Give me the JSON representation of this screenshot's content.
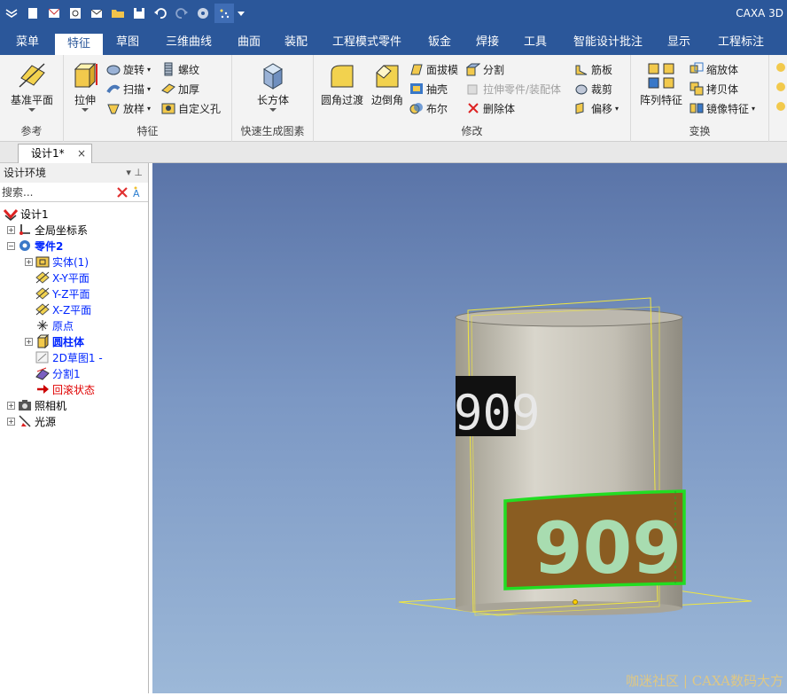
{
  "app": {
    "title": "CAXA 3D"
  },
  "quick_access": {
    "icons": [
      "app-logo-icon",
      "new-icon",
      "open-mail-icon",
      "scan-icon",
      "mail-icon",
      "folder-icon",
      "save-icon",
      "undo-icon",
      "redo-icon",
      "gear-icon",
      "sparkle-icon",
      "dropdown-icon"
    ]
  },
  "tabs": [
    {
      "label": "菜单"
    },
    {
      "label": "特征"
    },
    {
      "label": "草图"
    },
    {
      "label": "三维曲线"
    },
    {
      "label": "曲面"
    },
    {
      "label": "装配"
    },
    {
      "label": "工程模式零件"
    },
    {
      "label": "钣金"
    },
    {
      "label": "焊接"
    },
    {
      "label": "工具"
    },
    {
      "label": "智能设计批注"
    },
    {
      "label": "显示"
    },
    {
      "label": "工程标注"
    }
  ],
  "ribbon": {
    "ref": {
      "label": "参考",
      "base_plane": "基准平面"
    },
    "feature": {
      "label": "特征",
      "extrude": "拉伸",
      "revolve": "旋转",
      "sweep": "扫描",
      "loft": "放样",
      "thread": "螺纹",
      "thicken": "加厚",
      "custom_hole": "自定义孔"
    },
    "quick": {
      "label": "快速生成图素",
      "box": "长方体"
    },
    "modify": {
      "label": "修改",
      "fillet": "圆角过渡",
      "chamfer": "边倒角",
      "draft": "面拔模",
      "shell": "抽壳",
      "boolean": "布尔",
      "split": "分割",
      "extrude_part": "拉伸零件/装配体",
      "delete_body": "删除体",
      "rib": "筋板",
      "trim": "裁剪",
      "offset": "偏移"
    },
    "transform": {
      "label": "变换",
      "pattern": "阵列特征",
      "scale": "缩放体",
      "copy": "拷贝体",
      "mirror": "镜像特征"
    }
  },
  "document": {
    "tab_label": "设计1*",
    "close": "×"
  },
  "panel": {
    "title": "设计环境",
    "pin": "▾ ⊥",
    "search_placeholder": "搜索...",
    "tree": [
      {
        "label": "设计1"
      },
      {
        "label": "全局坐标系"
      },
      {
        "label": "零件2"
      },
      {
        "label": "实体(1)"
      },
      {
        "label": "X-Y平面"
      },
      {
        "label": "Y-Z平面"
      },
      {
        "label": "X-Z平面"
      },
      {
        "label": "原点"
      },
      {
        "label": "圆柱体"
      },
      {
        "label": "2D草图1 -"
      },
      {
        "label": "分割1"
      },
      {
        "label": "回滚状态"
      },
      {
        "label": "照相机"
      },
      {
        "label": "光源"
      }
    ]
  },
  "viewport": {
    "label_top": "909",
    "label_bottom": "909",
    "watermark": "咖迷社区 | CAXA数码大方"
  }
}
